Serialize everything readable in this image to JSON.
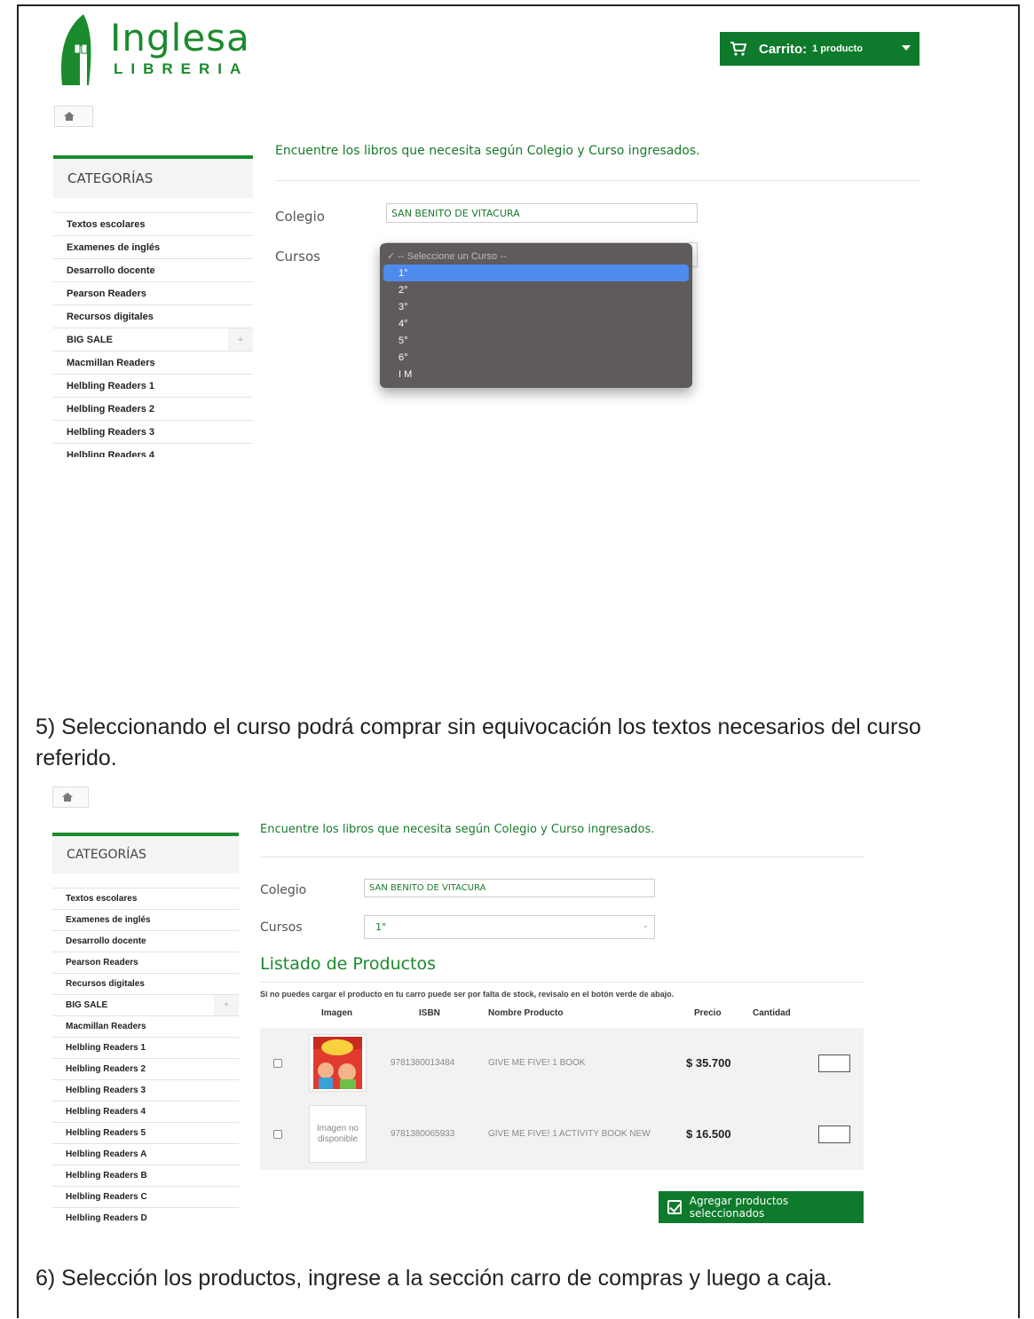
{
  "logo": {
    "name": "Inglesa",
    "sub": "LIBRERIA"
  },
  "cart": {
    "label": "Carrito:",
    "count": "1 producto"
  },
  "home_icon": "home-icon",
  "intro": "Encuentre los libros que necesita según Colegio y Curso ingresados.",
  "sidebar": {
    "heading": "CATEGORÍAS",
    "items_top": [
      "Textos escolares",
      "Examenes de inglés",
      "Desarrollo docente",
      "Pearson Readers",
      "Recursos digitales",
      "BIG SALE",
      "Macmillan Readers",
      "Helbling Readers 1",
      "Helbling Readers 2",
      "Helbling Readers 3",
      "Helbling Readers 4"
    ],
    "items_bottom": [
      "Textos escolares",
      "Examenes de inglés",
      "Desarrollo docente",
      "Pearson Readers",
      "Recursos digitales",
      "BIG SALE",
      "Macmillan Readers",
      "Helbling Readers 1",
      "Helbling Readers 2",
      "Helbling Readers 3",
      "Helbling Readers 4",
      "Helbling Readers 5",
      "Helbling Readers A",
      "Helbling Readers B",
      "Helbling Readers C",
      "Helbling Readers D"
    ],
    "expand_symbol": "+"
  },
  "form": {
    "colegio_label": "Colegio",
    "colegio_value": "SAN BENITO DE VITACURA",
    "cursos_label": "Cursos",
    "cursos_value": "1°"
  },
  "dropdown": {
    "header": "✓ -- Seleccione un Curso --",
    "options": [
      "1°",
      "2°",
      "3°",
      "4°",
      "5°",
      "6°",
      "I M"
    ],
    "selected": "1°"
  },
  "caption5": "5) Seleccionando el curso podrá comprar sin equivocación los textos necesarios del curso referido.",
  "caption6": "6) Selección los productos, ingrese a la sección carro de compras y luego a caja.",
  "products": {
    "title": "Listado de Productos",
    "note": "Si no puedes cargar el producto en tu carro puede ser por falta de stock, revisalo en el botón verde de abajo.",
    "headers": {
      "image": "Imagen",
      "isbn": "ISBN",
      "name": "Nombre Producto",
      "price": "Precio",
      "qty": "Cantidad"
    },
    "rows": [
      {
        "isbn": "9781380013484",
        "name": "GIVE ME FIVE! 1 BOOK",
        "price": "$ 35.700",
        "image": "book-cover"
      },
      {
        "isbn": "9781380065933",
        "name": "GIVE ME FIVE! 1 ACTIVITY BOOK NEW",
        "price": "$ 16.500",
        "image_text": "Imagen no disponible"
      }
    ],
    "add_button": "Agregar productos seleccionados"
  }
}
